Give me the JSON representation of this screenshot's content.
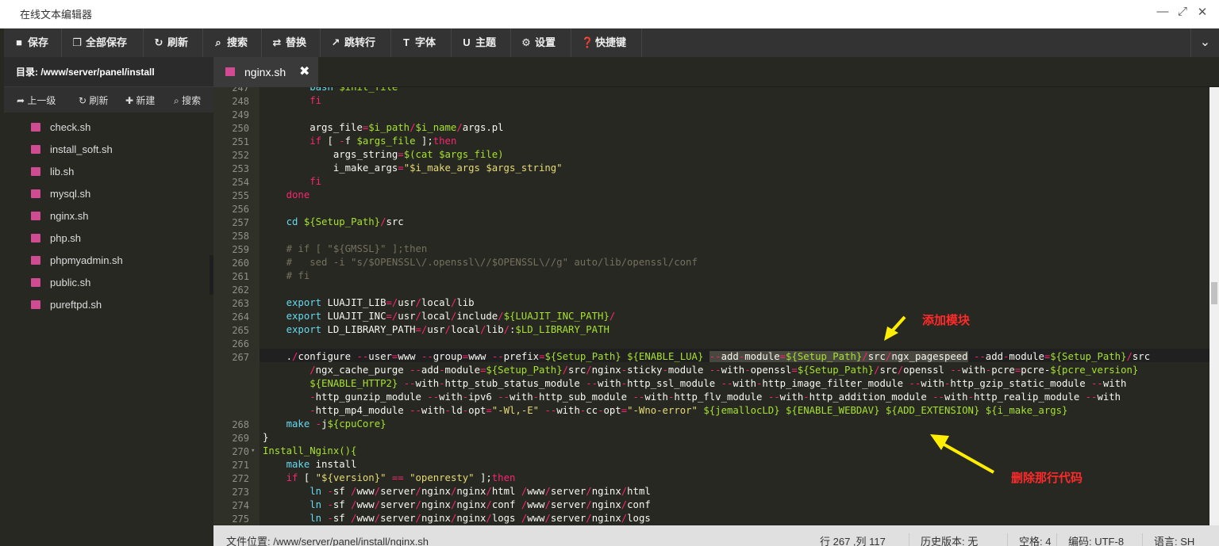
{
  "window": {
    "title": "在线文本编辑器",
    "controls": [
      "—",
      "⤢",
      "✕"
    ]
  },
  "toolbar": [
    {
      "icon": "save-icon",
      "label": "保存"
    },
    {
      "icon": "save-all-icon",
      "label": "全部保存"
    },
    {
      "icon": "refresh-icon",
      "label": "刷新"
    },
    {
      "icon": "search-icon",
      "label": "搜索"
    },
    {
      "icon": "replace-icon",
      "label": "替换"
    },
    {
      "icon": "goto-line-icon",
      "label": "跳转行"
    },
    {
      "icon": "font-icon",
      "label": "字体"
    },
    {
      "icon": "theme-icon",
      "label": "主题"
    },
    {
      "icon": "gear-icon",
      "label": "设置"
    },
    {
      "icon": "help-icon",
      "label": "快捷键"
    }
  ],
  "sidebar": {
    "path_label": "目录: /www/server/panel/install",
    "tools": [
      {
        "icon": "up-arrow-icon",
        "label": "上一级"
      },
      {
        "icon": "refresh-icon",
        "label": "刷新"
      },
      {
        "icon": "plus-icon",
        "label": "新建"
      },
      {
        "icon": "search-icon",
        "label": "搜索"
      }
    ],
    "files": [
      "check.sh",
      "install_soft.sh",
      "lib.sh",
      "mysql.sh",
      "nginx.sh",
      "php.sh",
      "phpmyadmin.sh",
      "public.sh",
      "pureftpd.sh"
    ]
  },
  "tab": {
    "name": "nginx.sh",
    "close": "✖"
  },
  "editor": {
    "line_numbers": [
      "247",
      "248",
      "249",
      "250",
      "251",
      "252",
      "253",
      "254",
      "255",
      "256",
      "257",
      "258",
      "259",
      "260",
      "261",
      "262",
      "263",
      "264",
      "265",
      "266",
      "267",
      "",
      "",
      "",
      "",
      "268",
      "269",
      "270",
      "271",
      "272",
      "273",
      "274",
      "275"
    ],
    "lines": [
      "        bash $init_file",
      "        fi",
      "",
      "        args_file=$i_path/$i_name/args.pl",
      "        if [ -f $args_file ];then",
      "            args_string=$(cat $args_file)",
      "            i_make_args=\"$i_make_args $args_string\"",
      "        fi",
      "    done",
      "",
      "    cd ${Setup_Path}/src",
      "",
      "    # if [ \"${GMSSL}\" ];then",
      "    #   sed -i \"s/$OPENSSL\\/.openssl\\//$OPENSSL\\//g\" auto/lib/openssl/conf",
      "    # fi",
      "",
      "    export LUAJIT_LIB=/usr/local/lib",
      "    export LUAJIT_INC=/usr/local/include/${LUAJIT_INC_PATH}/",
      "    export LD_LIBRARY_PATH=/usr/local/lib/:$LD_LIBRARY_PATH",
      "",
      "    ./configure --user=www --group=www --prefix=${Setup_Path} ${ENABLE_LUA} --add-module=${Setup_Path}/src/ngx_pagespeed --add-module=${Setup_Path}/src",
      "        /ngx_cache_purge --add-module=${Setup_Path}/src/nginx-sticky-module --with-openssl=${Setup_Path}/src/openssl --with-pcre=pcre-${pcre_version}",
      "        ${ENABLE_HTTP2} --with-http_stub_status_module --with-http_ssl_module --with-http_image_filter_module --with-http_gzip_static_module --with",
      "        -http_gunzip_module --with-ipv6 --with-http_sub_module --with-http_flv_module --with-http_addition_module --with-http_realip_module --with",
      "        -http_mp4_module --with-ld-opt=\"-Wl,-E\" --with-cc-opt=\"-Wno-error\" ${jemallocLD} ${ENABLE_WEBDAV} ${ADD_EXTENSION} ${i_make_args}",
      "    make -j${cpuCore}",
      "}",
      "Install_Nginx(){",
      "    make install",
      "    if [ \"${version}\" == \"openresty\" ];then",
      "        ln -sf /www/server/nginx/nginx/html /www/server/nginx/html",
      "        ln -sf /www/server/nginx/nginx/conf /www/server/nginx/conf",
      "        ln -sf /www/server/nginx/nginx/logs /www/server/nginx/logs"
    ],
    "fold_marker": "▾"
  },
  "status": {
    "file_path": "文件位置: /www/server/panel/install/nginx.sh",
    "position": "行 267 ,列 117",
    "history": "历史版本: 无",
    "indent": "空格: 4",
    "encoding": "编码: UTF-8",
    "language": "语言: SH"
  },
  "annotations": {
    "add_module": "添加模块",
    "delete_line": "删除那行代码"
  },
  "colors": {
    "annotation": "#ff2a2a",
    "arrow": "#ffee00",
    "editor_bg": "#272822"
  }
}
